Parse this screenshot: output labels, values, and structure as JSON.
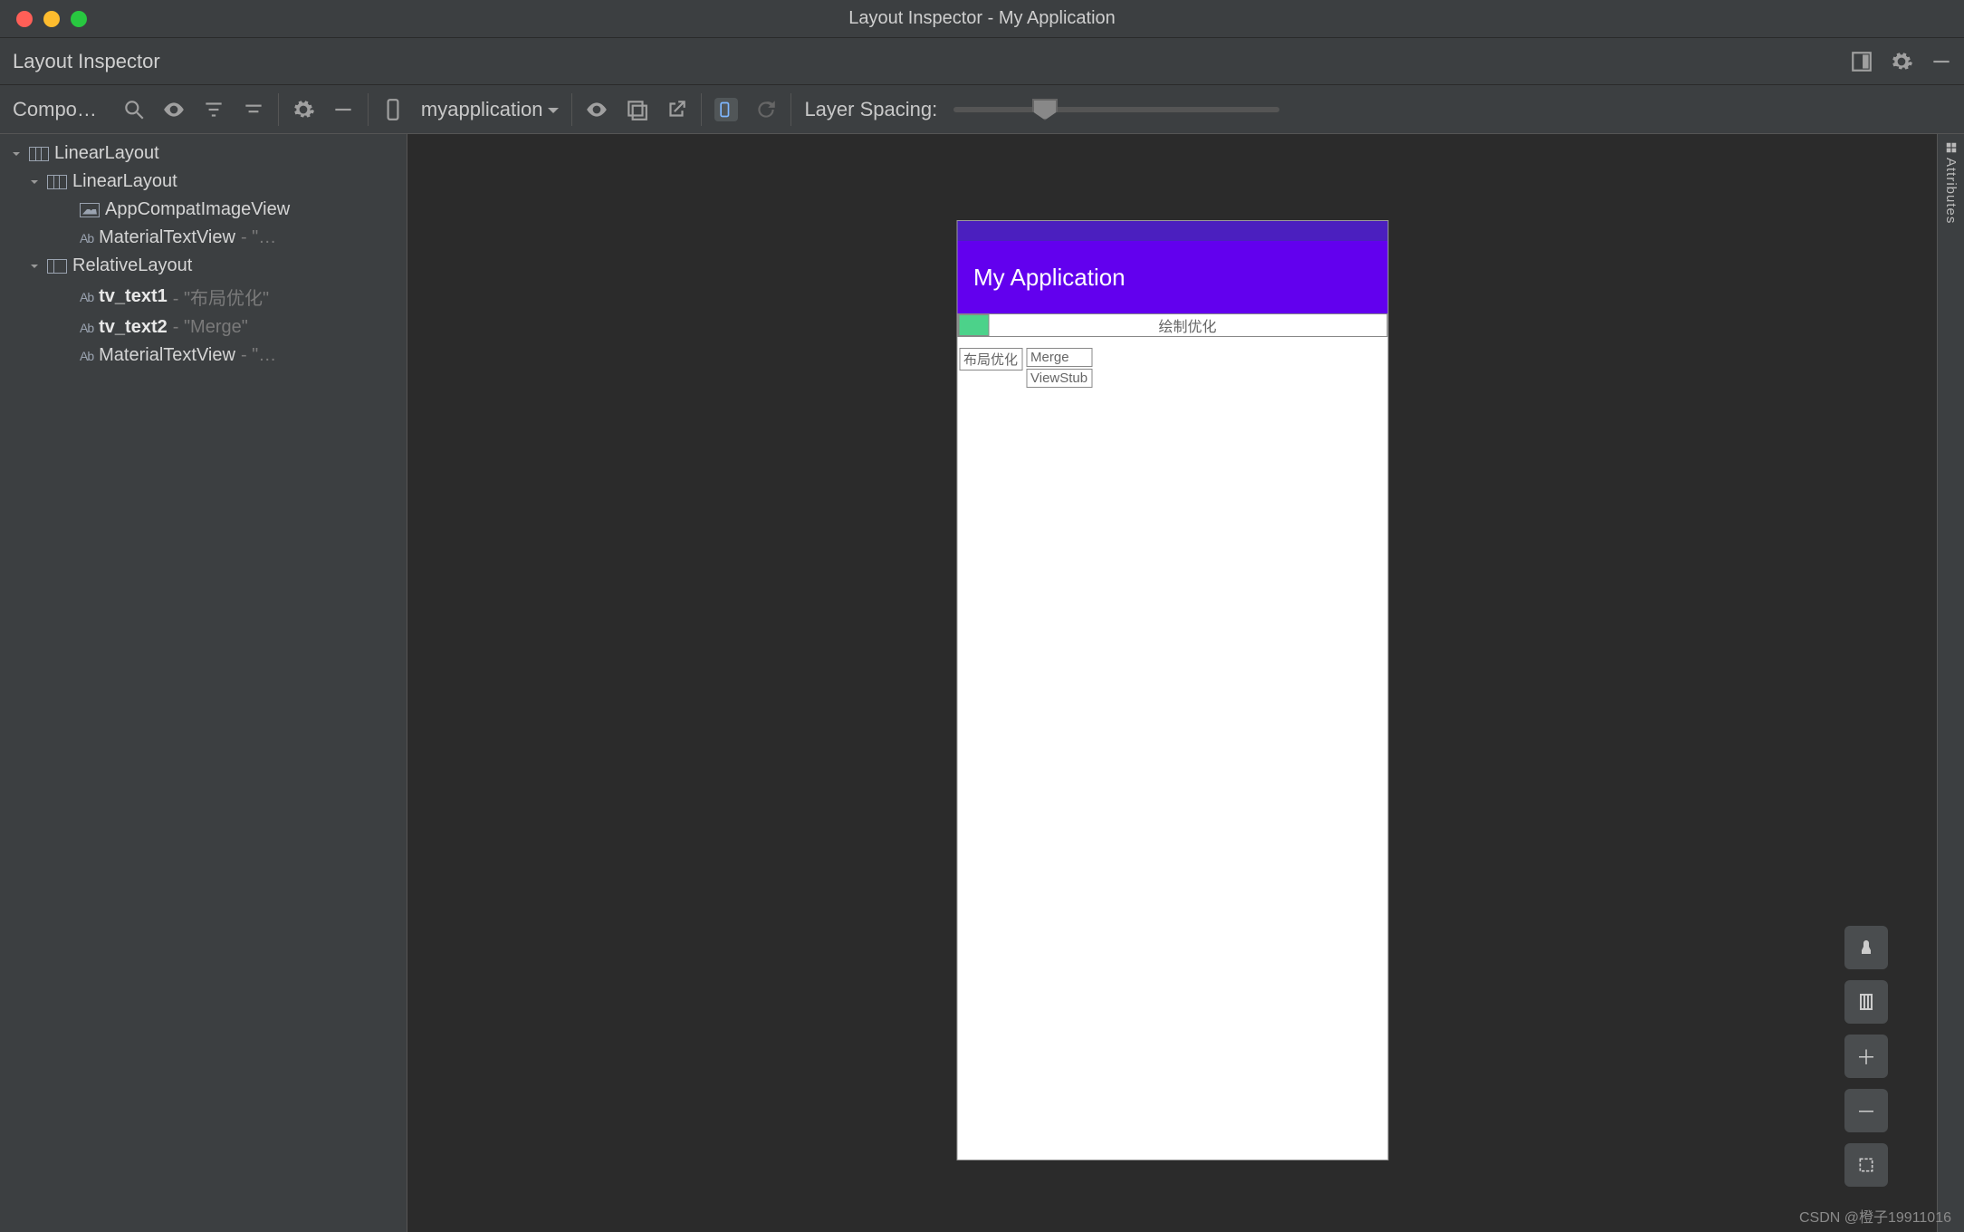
{
  "window": {
    "title": "Layout Inspector - My Application"
  },
  "toolbar_row": {
    "label": "Layout Inspector"
  },
  "toolbar2": {
    "compo_label": "Compo…",
    "device_label": "myapplication",
    "layer_spacing_label": "Layer Spacing:"
  },
  "tree": {
    "root": {
      "name": "LinearLayout"
    },
    "child_linear": {
      "name": "LinearLayout"
    },
    "imgview": {
      "name": "AppCompatImageView"
    },
    "mtv1": {
      "name": "MaterialTextView",
      "suffix": " - \"…"
    },
    "rel": {
      "name": "RelativeLayout"
    },
    "tv1": {
      "name": "tv_text1",
      "suffix": " - \"布局优化\""
    },
    "tv2": {
      "name": "tv_text2",
      "suffix": " - \"Merge\""
    },
    "mtv2": {
      "name": "MaterialTextView",
      "suffix": " - \"…"
    },
    "ab_prefix": "Ab"
  },
  "device": {
    "appbar_title": "My Application",
    "row1_text": "绘制优化",
    "row2_label": "布局优化",
    "merge": "Merge",
    "viewstub": "ViewStub"
  },
  "right_rail": {
    "label": "Attributes"
  },
  "view_controls": {
    "plus": "＋",
    "minus": "－"
  },
  "watermark": "CSDN @橙子19911016"
}
